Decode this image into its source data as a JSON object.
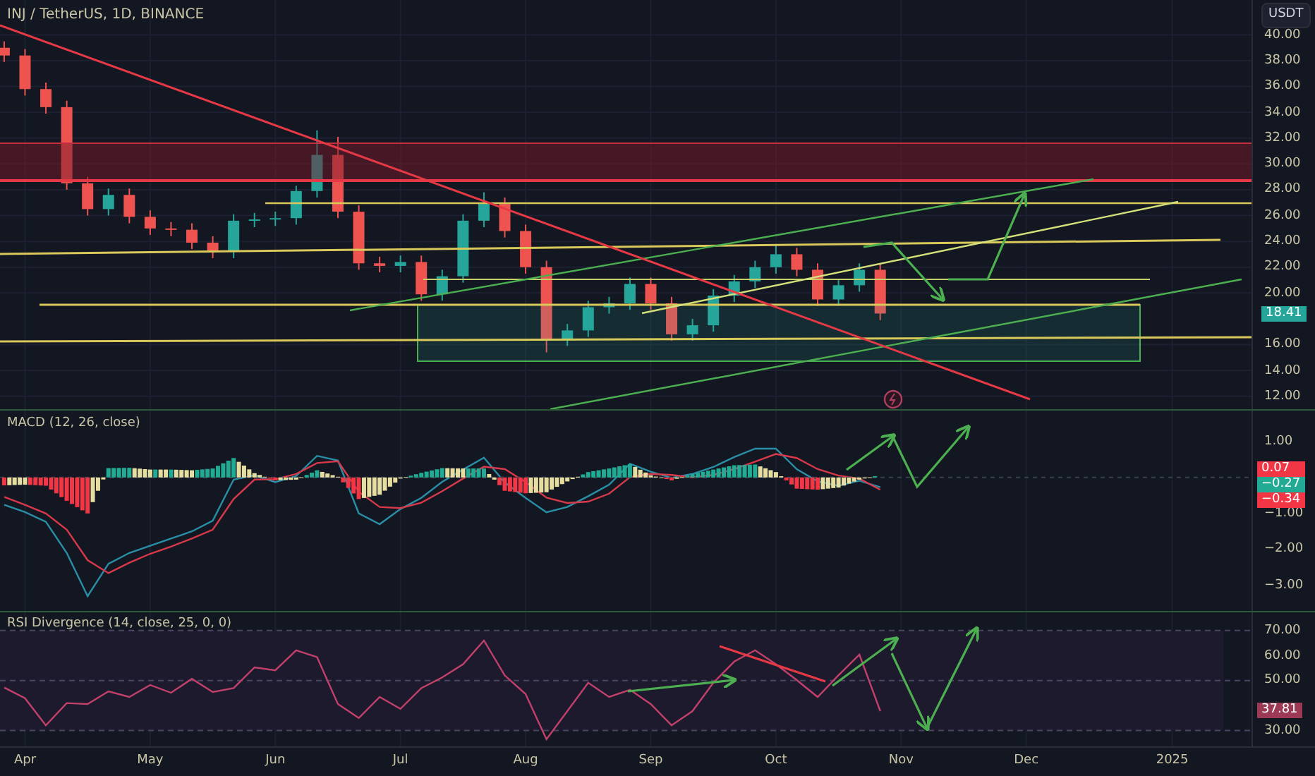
{
  "header": {
    "title": "INJ / TetherUS, 1D, BINANCE"
  },
  "currency_button": "USDT",
  "price_pane": {
    "last_price": "18.41",
    "chart_data": {
      "type": "candlestick",
      "grid": true,
      "ylim": [
        11,
        42.7
      ],
      "categories": [
        null,
        null,
        null,
        null,
        null,
        null,
        null,
        null,
        null,
        null,
        null,
        null,
        null,
        null,
        null,
        null,
        null,
        null,
        null,
        null,
        null,
        null,
        null,
        null,
        null,
        null,
        null,
        null,
        null,
        null,
        null,
        null,
        null,
        null,
        null,
        null,
        null,
        null,
        null,
        null,
        null,
        null,
        null,
        null,
        null,
        null,
        null,
        null,
        null,
        null,
        null,
        null,
        null,
        null,
        null,
        null,
        null,
        null,
        null,
        null
      ],
      "ohlc": [
        [
          39.0,
          39.5,
          37.9,
          38.4
        ],
        [
          38.4,
          38.9,
          35.3,
          35.8
        ],
        [
          35.8,
          36.3,
          33.9,
          34.4
        ],
        [
          34.4,
          34.9,
          28.0,
          28.5
        ],
        [
          28.5,
          29.0,
          26.0,
          26.5
        ],
        [
          26.5,
          28.1,
          26.0,
          27.6
        ],
        [
          27.6,
          28.1,
          25.4,
          25.9
        ],
        [
          25.9,
          26.4,
          24.5,
          25.0
        ],
        [
          25.0,
          25.5,
          24.4,
          24.9
        ],
        [
          24.9,
          25.4,
          23.4,
          23.9
        ],
        [
          23.9,
          24.4,
          22.7,
          23.2
        ],
        [
          23.2,
          26.1,
          22.7,
          25.6
        ],
        [
          25.6,
          26.2,
          25.1,
          25.7
        ],
        [
          25.7,
          26.3,
          25.2,
          25.8
        ],
        [
          25.8,
          28.3,
          25.3,
          27.9
        ],
        [
          27.9,
          32.6,
          27.4,
          30.7
        ],
        [
          30.7,
          32.1,
          25.8,
          26.3
        ],
        [
          26.3,
          26.8,
          21.8,
          22.3
        ],
        [
          22.3,
          22.8,
          21.6,
          22.1
        ],
        [
          22.1,
          22.9,
          21.6,
          22.4
        ],
        [
          22.4,
          22.9,
          19.4,
          19.9
        ],
        [
          19.9,
          21.8,
          19.4,
          21.3
        ],
        [
          21.3,
          26.1,
          20.8,
          25.6
        ],
        [
          25.6,
          27.8,
          25.1,
          26.9
        ],
        [
          26.9,
          27.4,
          24.3,
          24.8
        ],
        [
          24.8,
          25.3,
          21.5,
          22.0
        ],
        [
          22.0,
          22.5,
          15.4,
          16.4
        ],
        [
          16.4,
          17.6,
          15.9,
          17.1
        ],
        [
          17.1,
          19.4,
          16.6,
          18.9
        ],
        [
          18.9,
          19.7,
          18.4,
          19.2
        ],
        [
          19.2,
          21.2,
          18.7,
          20.7
        ],
        [
          20.7,
          21.2,
          18.7,
          19.2
        ],
        [
          19.2,
          19.7,
          16.3,
          16.8
        ],
        [
          16.8,
          18.0,
          16.3,
          17.5
        ],
        [
          17.5,
          20.3,
          17.0,
          19.8
        ],
        [
          19.8,
          21.4,
          19.3,
          20.9
        ],
        [
          20.9,
          22.5,
          20.4,
          22.0
        ],
        [
          22.0,
          23.8,
          21.5,
          23.0
        ],
        [
          23.0,
          23.5,
          21.3,
          21.8
        ],
        [
          21.8,
          22.3,
          19.0,
          19.5
        ],
        [
          19.5,
          21.1,
          19.0,
          20.6
        ],
        [
          20.6,
          22.3,
          20.1,
          21.8
        ],
        [
          21.8,
          22.3,
          17.9,
          18.41
        ],
        null,
        null,
        null,
        null,
        null,
        null,
        null,
        null,
        null,
        null,
        null,
        null,
        null,
        null,
        null,
        null,
        null
      ],
      "yticks": [
        {
          "value": 40,
          "label": "40.00"
        },
        {
          "value": 38,
          "label": "38.00"
        },
        {
          "value": 36,
          "label": "36.00"
        },
        {
          "value": 34,
          "label": "34.00"
        },
        {
          "value": 32,
          "label": "32.00"
        },
        {
          "value": 30,
          "label": "30.00"
        },
        {
          "value": 28,
          "label": "28.00"
        },
        {
          "value": 26,
          "label": "26.00"
        },
        {
          "value": 24,
          "label": "24.00"
        },
        {
          "value": 22,
          "label": "22.00"
        },
        {
          "value": 20,
          "label": "20.00"
        },
        {
          "value": 16,
          "label": "16.00"
        },
        {
          "value": 14,
          "label": "14.00"
        },
        {
          "value": 12,
          "label": "12.00"
        }
      ]
    }
  },
  "macd_pane": {
    "title": "MACD (12, 26, close)",
    "readings": [
      {
        "text": "0.07",
        "color": "#f23645"
      },
      {
        "text": "−0.27",
        "color": "#22ab94"
      },
      {
        "text": "−0.34",
        "color": "#f23645"
      }
    ],
    "chart_data": {
      "type": "line",
      "grid": true,
      "ylim": [
        -3.75,
        1.86
      ],
      "categories": [
        null,
        null,
        null,
        null,
        null,
        null,
        null,
        null,
        null,
        null,
        null,
        null,
        null,
        null,
        null,
        null,
        null,
        null,
        null,
        null,
        null,
        null,
        null,
        null,
        null,
        null,
        null,
        null,
        null,
        null,
        null,
        null,
        null,
        null,
        null,
        null,
        null,
        null,
        null,
        null,
        null,
        null,
        null,
        null,
        null,
        null,
        null,
        null,
        null,
        null,
        null,
        null,
        null,
        null,
        null,
        null,
        null,
        null,
        null,
        null
      ],
      "series": [
        {
          "color": "#2a8fa6",
          "values": [
            -0.76,
            -0.96,
            -1.23,
            -2.1,
            -3.3,
            -2.4,
            -2.1,
            -1.9,
            -1.7,
            -1.5,
            -1.2,
            -0.06,
            0.06,
            -0.13,
            0.04,
            0.6,
            0.47,
            -1.0,
            -1.3,
            -0.88,
            -0.57,
            -0.12,
            0.22,
            0.55,
            -0.14,
            -0.57,
            -0.97,
            -0.82,
            -0.52,
            -0.2,
            0.38,
            0.16,
            -0.01,
            0.1,
            0.29,
            0.57,
            0.8,
            0.8,
            0.23,
            -0.11,
            -0.23,
            -0.09,
            -0.27,
            null,
            null,
            null,
            null,
            null,
            null,
            null,
            null,
            null,
            null,
            null,
            null,
            null,
            null,
            null,
            null,
            null
          ]
        },
        {
          "color": "#d8394a",
          "values": [
            -0.54,
            -0.76,
            -1.0,
            -1.45,
            -2.3,
            -2.66,
            -2.37,
            -2.12,
            -1.92,
            -1.7,
            -1.45,
            -0.6,
            -0.06,
            -0.05,
            0.1,
            0.4,
            0.45,
            -0.4,
            -0.82,
            -0.85,
            -0.7,
            -0.38,
            -0.03,
            0.3,
            0.23,
            -0.13,
            -0.56,
            -0.71,
            -0.67,
            -0.45,
            0.01,
            0.1,
            0.07,
            0.0,
            0.07,
            0.23,
            0.44,
            0.65,
            0.54,
            0.23,
            0.05,
            -0.03,
            -0.34,
            null,
            null,
            null,
            null,
            null,
            null,
            null,
            null,
            null,
            null,
            null,
            null,
            null,
            null,
            null,
            null,
            null
          ]
        }
      ],
      "yticks": [
        {
          "value": 1,
          "label": "1.00"
        },
        {
          "value": -1,
          "label": "−1.00"
        },
        {
          "value": -2,
          "label": "−2.00"
        },
        {
          "value": -3,
          "label": "−3.00"
        }
      ]
    }
  },
  "rsi_pane": {
    "title": "RSI Divergence (14, close, 25, 0, 0)",
    "reading": "37.81",
    "chart_data": {
      "type": "line",
      "grid": true,
      "ylim": [
        23.1,
        77.3
      ],
      "categories": [
        null,
        "Apr",
        null,
        null,
        null,
        null,
        null,
        "May",
        null,
        null,
        null,
        null,
        null,
        "Jun",
        null,
        null,
        null,
        null,
        null,
        "Jul",
        null,
        null,
        null,
        null,
        null,
        "Aug",
        null,
        null,
        null,
        null,
        null,
        "Sep",
        null,
        null,
        null,
        null,
        null,
        "Oct",
        null,
        null,
        null,
        null,
        null,
        "Nov",
        null,
        null,
        null,
        null,
        null,
        "Dec",
        null,
        null,
        null,
        null,
        null,
        null,
        "2025",
        null,
        null,
        null
      ],
      "series": [
        {
          "color": "#c2416a",
          "values": [
            47.2,
            42.9,
            32.1,
            41.0,
            40.6,
            45.7,
            43.4,
            48.2,
            45.1,
            50.7,
            45.4,
            47.0,
            55.3,
            54.1,
            62.1,
            59.4,
            40.6,
            35.0,
            43.4,
            38.7,
            47.0,
            51.3,
            56.5,
            66.0,
            52.0,
            44.6,
            26.5,
            37.8,
            49.1,
            43.4,
            46.3,
            40.6,
            32.1,
            37.8,
            49.1,
            57.6,
            62.1,
            56.5,
            50.2,
            43.4,
            52.1,
            60.4,
            37.8,
            null,
            null,
            null,
            null,
            null,
            null,
            null,
            null,
            null,
            null,
            null,
            null,
            null,
            null,
            null,
            null,
            null
          ]
        }
      ],
      "yticks": [
        {
          "value": 70,
          "label": "70.00"
        },
        {
          "value": 60,
          "label": "60.00"
        },
        {
          "value": 50,
          "label": "50.00"
        },
        {
          "value": 30,
          "label": "30.00"
        }
      ]
    }
  }
}
